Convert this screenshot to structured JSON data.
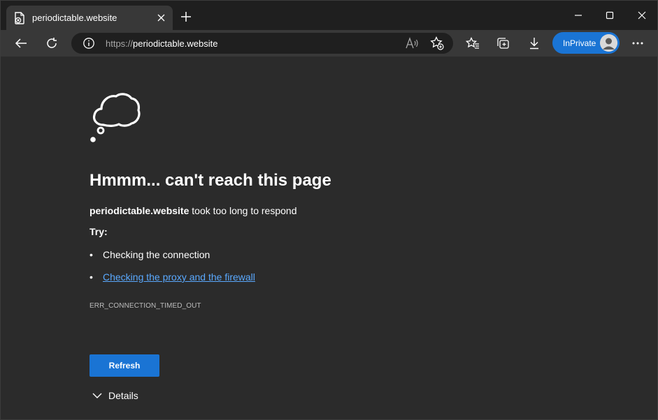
{
  "tab": {
    "title": "periodictable.website",
    "favicon": "page-error-icon"
  },
  "address_bar": {
    "scheme": "https://",
    "host": "periodictable.website"
  },
  "toolbar": {
    "inprivate_label": "InPrivate"
  },
  "error_page": {
    "illustration": "thought-cloud-icon",
    "heading": "Hmmm... can't reach this page",
    "host": "periodictable.website",
    "message": " took too long to respond",
    "try_label": "Try:",
    "suggestions": [
      {
        "text": "Checking the connection",
        "is_link": false
      },
      {
        "text": "Checking the proxy and the firewall",
        "is_link": true
      }
    ],
    "error_code": "ERR_CONNECTION_TIMED_OUT",
    "refresh_label": "Refresh",
    "details_label": "Details"
  },
  "colors": {
    "accent": "#1a74d4",
    "link": "#5aa9ff",
    "page_background": "#2b2b2b",
    "toolbar_background": "#383838",
    "titlebar_background": "#1f1f1f"
  }
}
